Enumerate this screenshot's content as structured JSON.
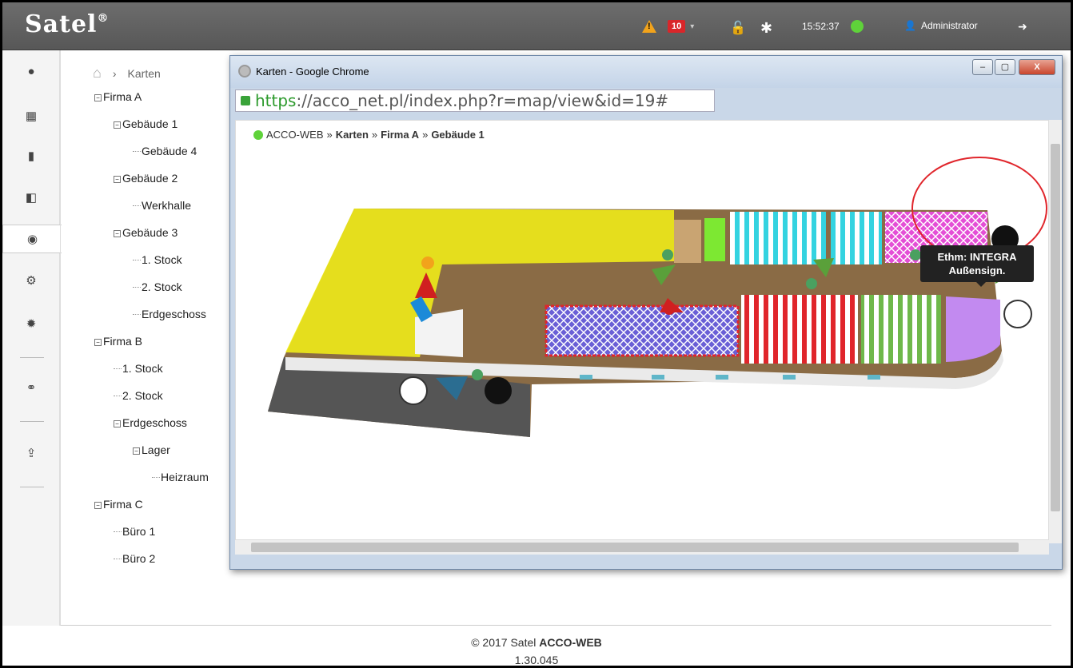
{
  "app": {
    "logo": "Satel",
    "logo_mark": "®"
  },
  "topbar": {
    "alarm_count": "10",
    "time": "15:52:37",
    "user": "Administrator"
  },
  "breadcrumb": {
    "current": "Karten"
  },
  "tree": [
    {
      "label": "Firma A",
      "level": 0,
      "expandable": true
    },
    {
      "label": "Gebäude 1",
      "level": 1,
      "expandable": true
    },
    {
      "label": "Gebäude 4",
      "level": 2,
      "expandable": false
    },
    {
      "label": "Gebäude 2",
      "level": 1,
      "expandable": true
    },
    {
      "label": "Werkhalle",
      "level": 2,
      "expandable": false
    },
    {
      "label": "Gebäude 3",
      "level": 1,
      "expandable": true
    },
    {
      "label": "1. Stock",
      "level": 2,
      "expandable": false
    },
    {
      "label": "2. Stock",
      "level": 2,
      "expandable": false
    },
    {
      "label": "Erdgeschoss",
      "level": 2,
      "expandable": false
    },
    {
      "label": "Firma B",
      "level": 0,
      "expandable": true
    },
    {
      "label": "1. Stock",
      "level": 1,
      "expandable": false
    },
    {
      "label": "2. Stock",
      "level": 1,
      "expandable": false
    },
    {
      "label": "Erdgeschoss",
      "level": 1,
      "expandable": true
    },
    {
      "label": "Lager",
      "level": 2,
      "expandable": true
    },
    {
      "label": "Heizraum",
      "level": 3,
      "expandable": false
    },
    {
      "label": "Firma C",
      "level": 0,
      "expandable": true
    },
    {
      "label": "Büro 1",
      "level": 1,
      "expandable": false
    },
    {
      "label": "Büro 2",
      "level": 1,
      "expandable": false
    }
  ],
  "popup": {
    "title": "Karten - Google Chrome",
    "url_scheme": "https",
    "url_rest": "://acco_net.pl/index.php?r=map/view&id=19#",
    "breadcrumb": [
      "ACCO-WEB",
      "Karten",
      "Firma A",
      "Gebäude 1"
    ],
    "tooltip_line1": "Ethm: INTEGRA",
    "tooltip_line2": "Außensign."
  },
  "footer": {
    "copyright": "© 2017 Satel ",
    "product": "ACCO-WEB",
    "version": "1.30.045"
  },
  "colors": {
    "accent_green": "#5fd23a",
    "alarm_red": "#d9262a",
    "warning": "#f2a31b"
  }
}
